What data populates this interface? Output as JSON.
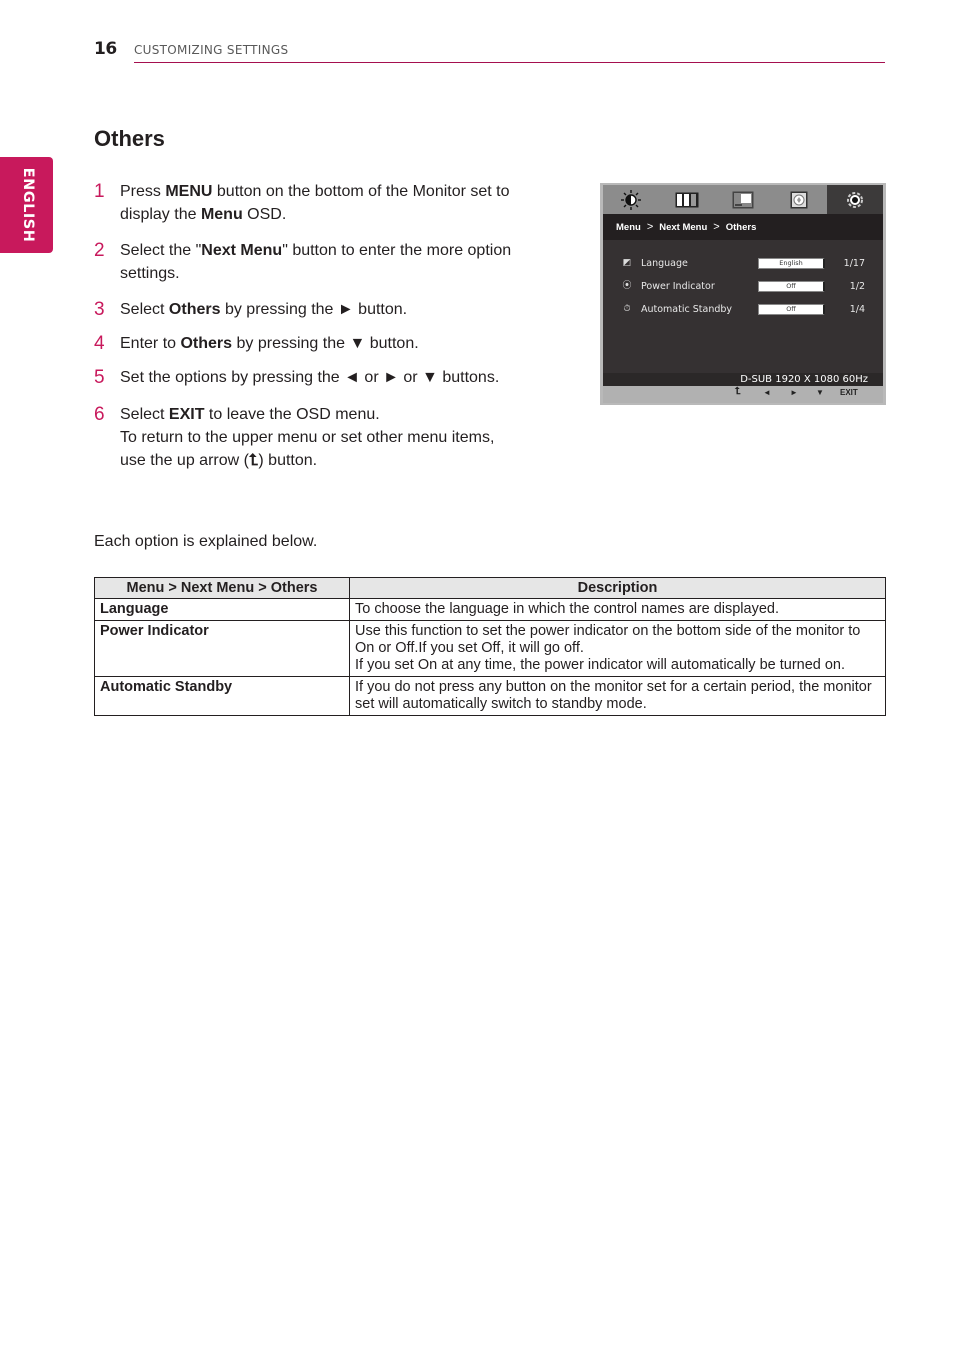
{
  "header": {
    "page_number": "16",
    "section_title": "CUSTOMIZING SETTINGS"
  },
  "side_tab": {
    "label": "ENGLISH",
    "color": "#c8195c"
  },
  "title": "Others",
  "steps": [
    {
      "num": "1",
      "parts": [
        {
          "t": "Press "
        },
        {
          "t": "MENU",
          "b": true
        },
        {
          "t": " button on the bottom of the Monitor set to display the "
        },
        {
          "t": "Menu",
          "b": true
        },
        {
          "t": " OSD."
        }
      ]
    },
    {
      "num": "2",
      "parts": [
        {
          "t": "Select the \""
        },
        {
          "t": "Next Menu",
          "b": true
        },
        {
          "t": "\" button to enter the more option settings."
        }
      ]
    },
    {
      "num": "3",
      "parts": [
        {
          "t": "Select "
        },
        {
          "t": "Others",
          "b": true
        },
        {
          "t": " by pressing the ► button."
        }
      ]
    },
    {
      "num": "4",
      "parts": [
        {
          "t": "Enter to "
        },
        {
          "t": "Others",
          "b": true
        },
        {
          "t": " by pressing the ▼ button."
        }
      ]
    },
    {
      "num": "5",
      "parts": [
        {
          "t": "Set the options by pressing the ◄ or ► or ▼ buttons."
        }
      ]
    },
    {
      "num": "6",
      "parts": [
        {
          "t": "Select "
        },
        {
          "t": "EXIT",
          "b": true
        },
        {
          "t": " to leave the OSD menu."
        }
      ],
      "extra": {
        "before": "To return to the upper menu or set other menu items, use the up arrow (",
        "icon": "⮤",
        "after": ") button."
      }
    }
  ],
  "osd": {
    "tabs": [
      "brightness-icon",
      "picture-icon",
      "screen-icon",
      "color-icon",
      "others-gear-icon"
    ],
    "selected_tab": 4,
    "breadcrumb": [
      "Menu",
      ">",
      "Next Menu",
      ">",
      "Others"
    ],
    "rows": [
      {
        "icon": "language-icon",
        "glyph": "◩",
        "label": "Language",
        "value": "English",
        "count": "1/17"
      },
      {
        "icon": "power-indicator-icon",
        "glyph": "⦿",
        "label": "Power Indicator",
        "value": "Off",
        "count": "1/2"
      },
      {
        "icon": "standby-timer-icon",
        "glyph": "⏱",
        "label": "Automatic Standby",
        "value": "Off",
        "count": "1/4"
      }
    ],
    "resolution": "D-SUB 1920 X 1080 60Hz",
    "buttons": {
      "up": "⮤",
      "left": "◄",
      "right": "►",
      "down": "▼",
      "exit": "EXIT"
    }
  },
  "intro": "Each option is explained below.",
  "table": {
    "headers": [
      "Menu > Next Menu > Others",
      "Description"
    ],
    "rows": [
      {
        "name": "Language",
        "desc": [
          "To choose the language in which the control names are displayed."
        ]
      },
      {
        "name": "Power Indicator",
        "desc": [
          "Use this function to set the power indicator on the bottom side of the monitor to On or Off.If you set Off, it will go off.",
          "If you set On at any time, the power indicator will automatically be turned on."
        ]
      },
      {
        "name": "Automatic Standby",
        "desc": [
          "If you do not press any button on the monitor set for a certain period, the monitor set will automatically switch to standby mode."
        ]
      }
    ]
  }
}
